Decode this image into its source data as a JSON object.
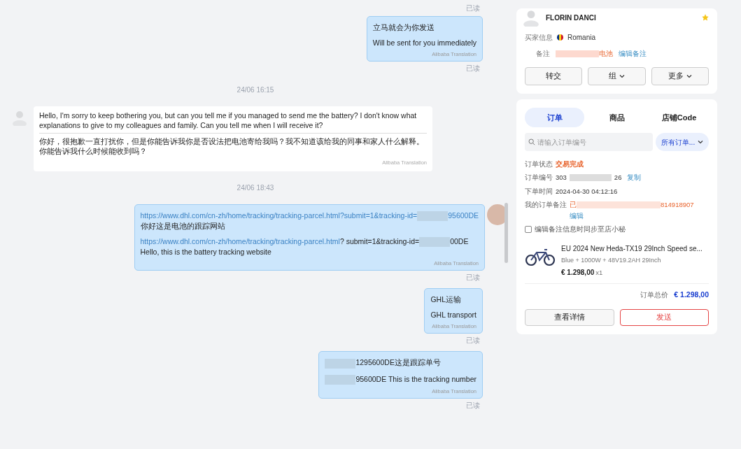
{
  "chat": [
    {
      "kind": "status",
      "text": "已读"
    },
    {
      "kind": "outgoing",
      "avatar": false,
      "blocks": [
        [
          [
            {
              "kind": "text",
              "text": "立马就会为你发送"
            }
          ]
        ],
        [
          [
            {
              "kind": "text",
              "text": "Will be sent for you immediately"
            }
          ]
        ]
      ],
      "credit": "Alibaba Translation",
      "status": "已读"
    },
    {
      "kind": "date",
      "text": "24/06 16:15"
    },
    {
      "kind": "incoming",
      "blocks": [
        [
          [
            {
              "kind": "text",
              "text": "Hello, I'm sorry to keep bothering you, but can you tell me if you managed to send me the battery? I don't know what explanations to give to my colleagues and family. Can you tell me when I will receive it?"
            }
          ]
        ],
        [
          [
            {
              "kind": "text",
              "text": "你好，很抱歉一直打扰你，但是你能告诉我你是否设法把电池寄给我吗？我不知道该给我的同事和家人什么解释。你能告诉我什么时候能收到吗？"
            }
          ]
        ]
      ],
      "credit": "Alibaba Translation"
    },
    {
      "kind": "date",
      "text": "24/06 18:43"
    },
    {
      "kind": "outgoing",
      "avatar": true,
      "blocks": [
        [
          [
            {
              "kind": "link",
              "text": "https://www.dhl.com/cn-zh/home/tracking/tracking-parcel.html?submit=1&tracking-id="
            },
            {
              "kind": "redacted"
            },
            {
              "kind": "link",
              "text": "95600DE"
            }
          ],
          [
            {
              "kind": "text",
              "text": "你好这是电池的跟踪网站"
            }
          ]
        ],
        [
          [
            {
              "kind": "link",
              "text": "https://www.dhl.com/cn-zh/home/tracking/tracking-parcel.html"
            },
            {
              "kind": "text",
              "text": "? submit=1&tracking-id="
            },
            {
              "kind": "redacted"
            },
            {
              "kind": "text",
              "text": "00DE"
            }
          ],
          [
            {
              "kind": "text",
              "text": "Hello, this is the battery tracking website"
            }
          ]
        ]
      ],
      "credit": "Alibaba Translation",
      "status": "已读"
    },
    {
      "kind": "outgoing",
      "avatar": false,
      "blocks": [
        [
          [
            {
              "kind": "text",
              "text": "GHL运输"
            }
          ]
        ],
        [
          [
            {
              "kind": "text",
              "text": "GHL transport"
            }
          ]
        ]
      ],
      "credit": "Alibaba Translation",
      "status": "已读"
    },
    {
      "kind": "outgoing",
      "avatar": false,
      "blocks": [
        [
          [
            {
              "kind": "redacted"
            },
            {
              "kind": "text",
              "text": "1295600DE这是跟踪单号"
            }
          ]
        ],
        [
          [
            {
              "kind": "redacted"
            },
            {
              "kind": "text",
              "text": "95600DE This is the tracking number"
            }
          ]
        ]
      ],
      "credit": "Alibaba Translation",
      "status": "已读"
    }
  ],
  "buyer": {
    "name": "FLORIN DANCI",
    "starred": true,
    "info_label": "买家信息",
    "country": "Romania",
    "note_label": "备注",
    "note_value": "电池",
    "note_edit": "编辑备注",
    "buttons": [
      {
        "label": "转交",
        "dropdown": false
      },
      {
        "label": "组",
        "dropdown": true
      },
      {
        "label": "更多",
        "dropdown": true
      }
    ]
  },
  "order_panel": {
    "tabs": [
      {
        "label": "订单",
        "selected": true
      },
      {
        "label": "商品",
        "selected": false
      },
      {
        "label": "店铺Code",
        "selected": false
      }
    ],
    "search": {
      "placeholder": "请输入订单编号"
    },
    "filter": "所有订单...",
    "status_label": "订单状态",
    "status_value": "交易完成",
    "number_label": "订单编号",
    "number_start": "303",
    "number_end": "26",
    "copy": "复制",
    "time_label": "下单时间",
    "time_value": "2024-04-30 04:12:16",
    "note_label": "我的订单备注",
    "note_start": "已",
    "note_end": "814918907",
    "note_edit": "编辑",
    "sync": {
      "label": "编辑备注信息时同步至店小秘",
      "checked": false
    },
    "product": {
      "title": "EU 2024 New Heda-TX19 29Inch Speed se...",
      "variant": "Blue + 1000W + 48V19.2AH 29Inch",
      "price": "€ 1.298,00",
      "qty": "x1"
    },
    "total_label": "订单总价",
    "total_value": "€ 1.298,00",
    "buttons": [
      {
        "label": "查看详情",
        "kind": "secondary"
      },
      {
        "label": "发送",
        "kind": "primary"
      }
    ]
  }
}
